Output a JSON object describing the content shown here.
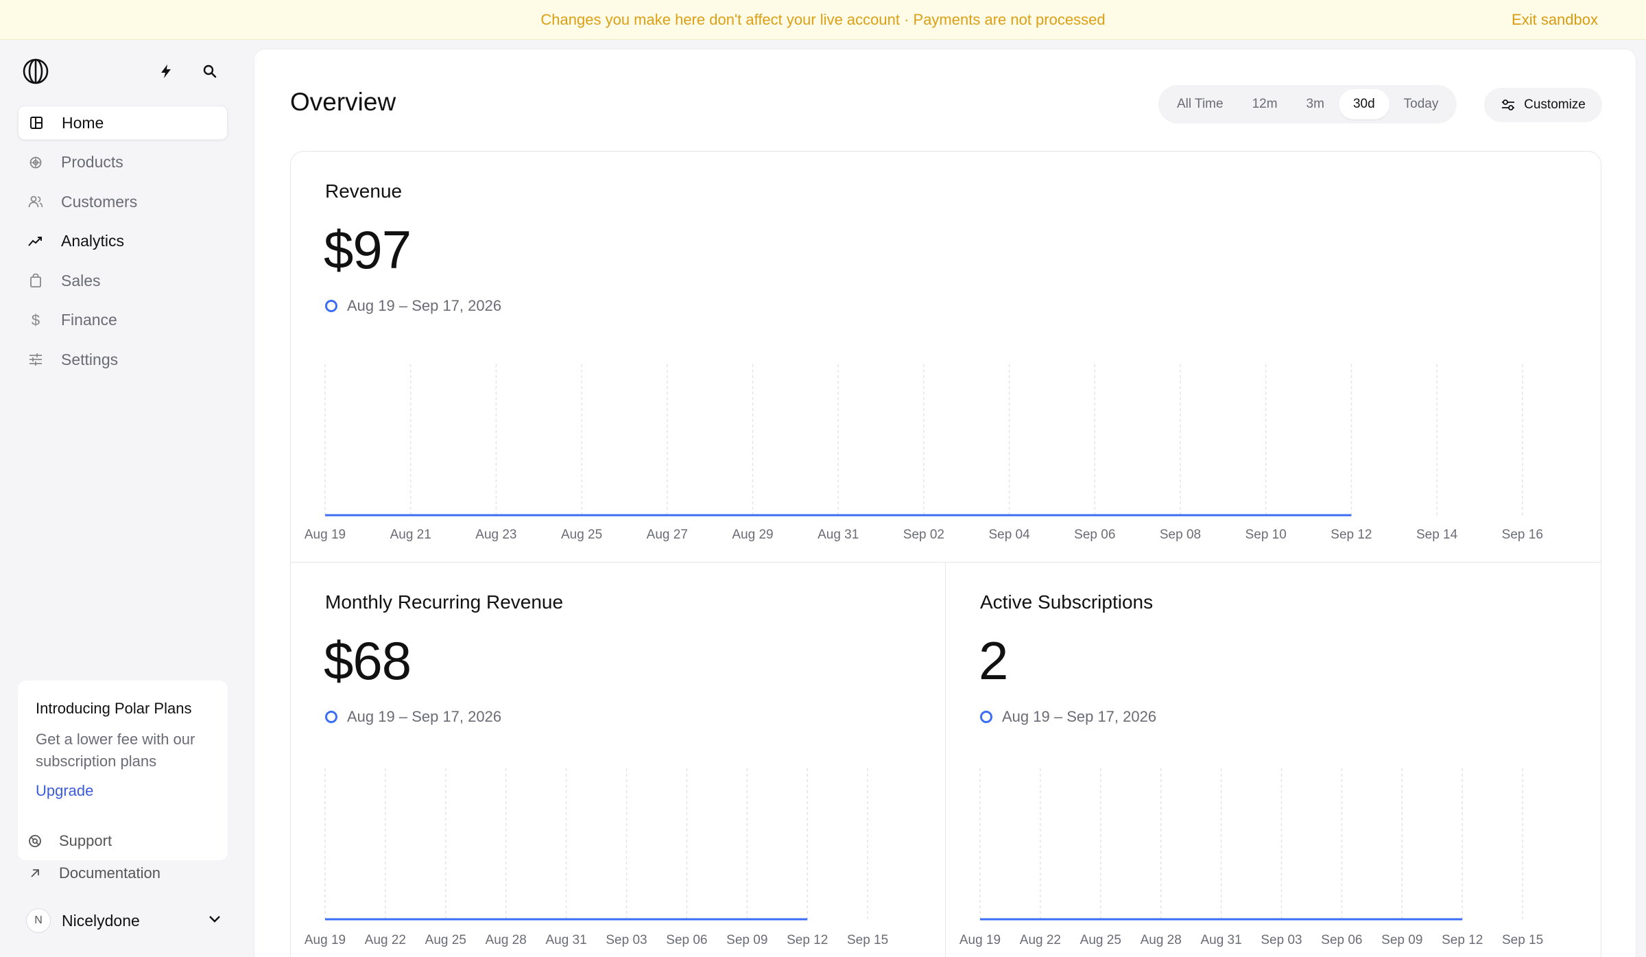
{
  "banner": {
    "message": "Changes you make here don't affect your live account · Payments are not processed",
    "exit_label": "Exit sandbox"
  },
  "sidebar": {
    "items": [
      {
        "label": "Home",
        "icon": "home-icon",
        "active": true
      },
      {
        "label": "Products",
        "icon": "products-icon",
        "active": false
      },
      {
        "label": "Customers",
        "icon": "customers-icon",
        "active": false
      },
      {
        "label": "Analytics",
        "icon": "analytics-icon",
        "active": false
      },
      {
        "label": "Sales",
        "icon": "bag-icon",
        "active": false
      },
      {
        "label": "Finance",
        "icon": "dollar-icon",
        "active": false
      },
      {
        "label": "Settings",
        "icon": "sliders-icon",
        "active": false
      }
    ],
    "promo": {
      "title": "Introducing Polar Plans",
      "description": "Get a lower fee with our subscription plans",
      "link": "Upgrade"
    },
    "support_label": "Support",
    "docs_label": "Documentation",
    "user": {
      "initial": "N",
      "name": "Nicelydone"
    }
  },
  "header": {
    "title": "Overview",
    "ranges": [
      "All Time",
      "12m",
      "3m",
      "30d",
      "Today"
    ],
    "selected_range": "30d",
    "customize_label": "Customize"
  },
  "colors": {
    "accent": "#3b6ef5",
    "banner_text": "#dba017",
    "link": "#3b5bdb"
  },
  "chart_data": [
    {
      "type": "line",
      "title": "Revenue",
      "value": "$97",
      "range": "Aug 19 – Sep 17, 2026",
      "x": [
        "Aug 19",
        "Aug 21",
        "Aug 23",
        "Aug 25",
        "Aug 27",
        "Aug 29",
        "Aug 31",
        "Sep 02",
        "Sep 04",
        "Sep 06",
        "Sep 08",
        "Sep 10",
        "Sep 12",
        "Sep 14",
        "Sep 16"
      ],
      "values": [
        0,
        0,
        0,
        0,
        0,
        0,
        0,
        0,
        0,
        0,
        0,
        0,
        0
      ],
      "grid": "vertical dashed"
    },
    {
      "type": "line",
      "title": "Monthly Recurring Revenue",
      "value": "$68",
      "range": "Aug 19 – Sep 17, 2026",
      "x": [
        "Aug 19",
        "Aug 22",
        "Aug 25",
        "Aug 28",
        "Aug 31",
        "Sep 03",
        "Sep 06",
        "Sep 09",
        "Sep 12",
        "Sep 15"
      ],
      "values": [
        0,
        0,
        0,
        0,
        0,
        0,
        0,
        0,
        0
      ],
      "grid": "vertical dashed"
    },
    {
      "type": "line",
      "title": "Active Subscriptions",
      "value": "2",
      "range": "Aug 19 – Sep 17, 2026",
      "x": [
        "Aug 19",
        "Aug 22",
        "Aug 25",
        "Aug 28",
        "Aug 31",
        "Sep 03",
        "Sep 06",
        "Sep 09",
        "Sep 12",
        "Sep 15"
      ],
      "values": [
        0,
        0,
        0,
        0,
        0,
        0,
        0,
        0,
        0
      ],
      "grid": "vertical dashed"
    }
  ]
}
